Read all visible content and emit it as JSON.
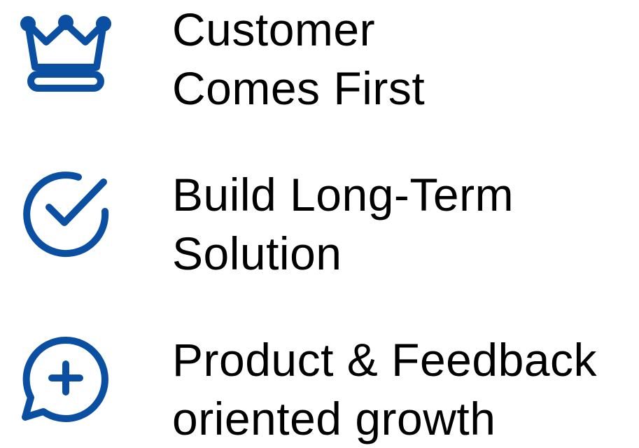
{
  "colors": {
    "icon_stroke": "#0b4fa3",
    "text": "#000000",
    "background": "#ffffff"
  },
  "items": [
    {
      "icon": "crown-icon",
      "line1": "Customer",
      "line2": "Comes First"
    },
    {
      "icon": "check-circle-icon",
      "line1": "Build Long-Term",
      "line2": "Solution"
    },
    {
      "icon": "chat-plus-icon",
      "line1": "Product & Feedback",
      "line2": "oriented growth"
    }
  ]
}
